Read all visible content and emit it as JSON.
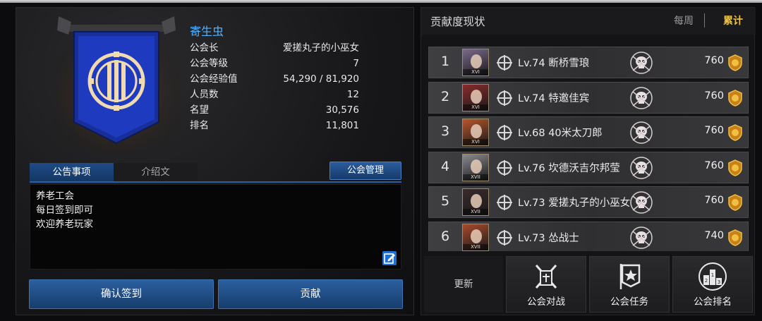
{
  "guild": {
    "name": "寄生虫",
    "fields": [
      {
        "label": "公会长",
        "value": "爱搓丸子的小巫女"
      },
      {
        "label": "公会等级",
        "value": "7"
      },
      {
        "label": "公会经验值",
        "value": "54,290 / 81,920"
      },
      {
        "label": "人员数",
        "value": "12"
      },
      {
        "label": "名望",
        "value": "30,576"
      },
      {
        "label": "排名",
        "value": "11,801"
      }
    ]
  },
  "tabs": [
    {
      "label": "公告事项",
      "active": true
    },
    {
      "label": "介绍文",
      "active": false
    }
  ],
  "manage_button": "公会管理",
  "notice_lines": [
    "养老工会",
    "每日签到即可",
    "欢迎养老玩家"
  ],
  "buttons": {
    "checkin": "确认签到",
    "contribute": "贡献"
  },
  "contribution": {
    "title": "贡献度现状",
    "filter_weekly": "每周",
    "filter_total": "累计",
    "rows": [
      {
        "rank": "1",
        "tier": "XVI",
        "name": "Lv.74 断桥雪琅",
        "score": "760"
      },
      {
        "rank": "2",
        "tier": "XVI",
        "name": "Lv.74 特邀佳宾",
        "score": "760"
      },
      {
        "rank": "3",
        "tier": "XVI",
        "name": "Lv.68 40米太刀郎",
        "score": "760"
      },
      {
        "rank": "4",
        "tier": "XVII",
        "name": "Lv.76 坎德沃吉尔邦莹",
        "score": "760"
      },
      {
        "rank": "5",
        "tier": "XVII",
        "name": "Lv.73 爱搓丸子的小巫女",
        "score": "760"
      },
      {
        "rank": "6",
        "tier": "XVII",
        "name": "Lv.73 怂战士",
        "score": "740"
      }
    ]
  },
  "bottom": {
    "update": "更新",
    "actions": [
      {
        "label": "公会对战",
        "icon": "crossed-swords-icon"
      },
      {
        "label": "公会任务",
        "icon": "quest-banner-icon"
      },
      {
        "label": "公会排名",
        "icon": "ranking-podium-icon"
      }
    ]
  },
  "colors": {
    "accent_blue": "#4fb3ff",
    "highlight_gold": "#f0c343",
    "button_blue": "#2b5f9e"
  }
}
